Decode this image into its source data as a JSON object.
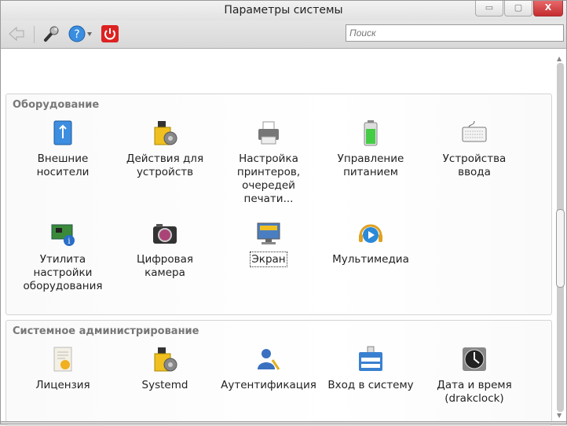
{
  "window": {
    "title": "Параметры системы",
    "minimize": "▭",
    "maximize": "▢",
    "close": "X"
  },
  "toolbar": {
    "search_placeholder": "Поиск"
  },
  "sections": [
    {
      "title": "Оборудование",
      "items": [
        {
          "label": "Внешние носители",
          "icon": "usb-drive-icon"
        },
        {
          "label": "Действия для устройств",
          "icon": "usb-gear-icon"
        },
        {
          "label": "Настройка принтеров, очередей печати...",
          "icon": "printer-icon"
        },
        {
          "label": "Управление питанием",
          "icon": "battery-icon"
        },
        {
          "label": "Устройства ввода",
          "icon": "keyboard-icon"
        },
        {
          "label": "Утилита настройки оборудования",
          "icon": "hardware-card-icon"
        },
        {
          "label": "Цифровая камера",
          "icon": "camera-icon"
        },
        {
          "label": "Экран",
          "icon": "display-icon"
        },
        {
          "label": "Мультимедиа",
          "icon": "multimedia-icon"
        }
      ]
    },
    {
      "title": "Системное администрирование",
      "items": [
        {
          "label": "Лицензия",
          "icon": "certificate-icon"
        },
        {
          "label": "Systemd",
          "icon": "usb-gear-icon"
        },
        {
          "label": "Аутентификация",
          "icon": "user-key-icon"
        },
        {
          "label": "Вход в систему",
          "icon": "login-icon"
        },
        {
          "label": "Дата и время (drakclock)",
          "icon": "clock-icon"
        }
      ]
    }
  ]
}
